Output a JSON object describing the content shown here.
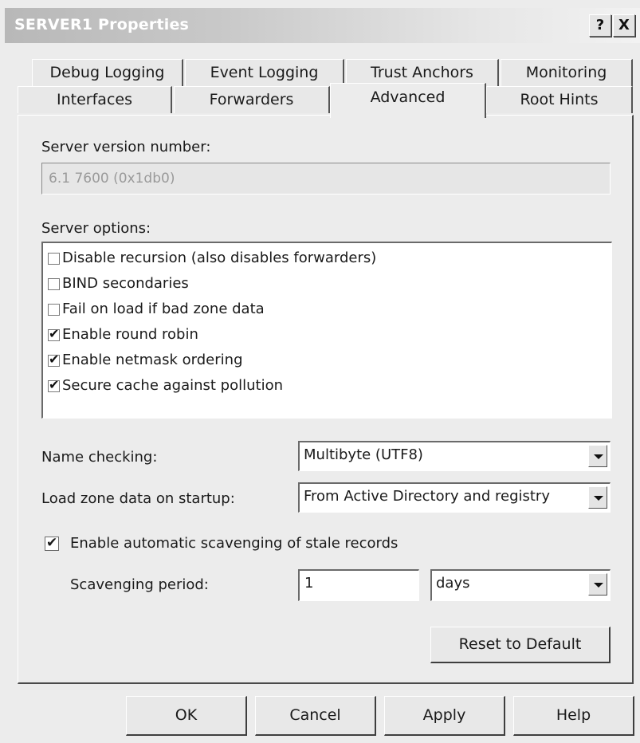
{
  "window": {
    "title": "SERVER1 Properties",
    "help_glyph": "?",
    "close_glyph": "X"
  },
  "tabs_row1": [
    "Debug Logging",
    "Event Logging",
    "Trust Anchors",
    "Monitoring"
  ],
  "tabs_row2": [
    "Interfaces",
    "Forwarders",
    "Advanced",
    "Root Hints"
  ],
  "active_tab": "Advanced",
  "advanced": {
    "server_version_label": "Server version number:",
    "server_version_value": "6.1 7600 (0x1db0)",
    "server_options_label": "Server options:",
    "options": [
      {
        "label": "Disable recursion (also disables forwarders)",
        "checked": false
      },
      {
        "label": "BIND secondaries",
        "checked": false
      },
      {
        "label": "Fail on load if bad zone data",
        "checked": false
      },
      {
        "label": "Enable round robin",
        "checked": true
      },
      {
        "label": "Enable netmask ordering",
        "checked": true
      },
      {
        "label": "Secure cache against pollution",
        "checked": true
      }
    ],
    "name_checking_label": "Name checking:",
    "name_checking_value": "Multibyte (UTF8)",
    "load_zone_label": "Load zone data on startup:",
    "load_zone_value": "From Active Directory and registry",
    "scavenging_checkbox_label": "Enable automatic scavenging of stale records",
    "scavenging_checked": true,
    "scavenging_period_label": "Scavenging period:",
    "scavenging_period_value": "1",
    "scavenging_unit_value": "days",
    "reset_button": "Reset to Default"
  },
  "footer": {
    "ok": "OK",
    "cancel": "Cancel",
    "apply": "Apply",
    "help": "Help"
  },
  "check_glyph": "✔"
}
